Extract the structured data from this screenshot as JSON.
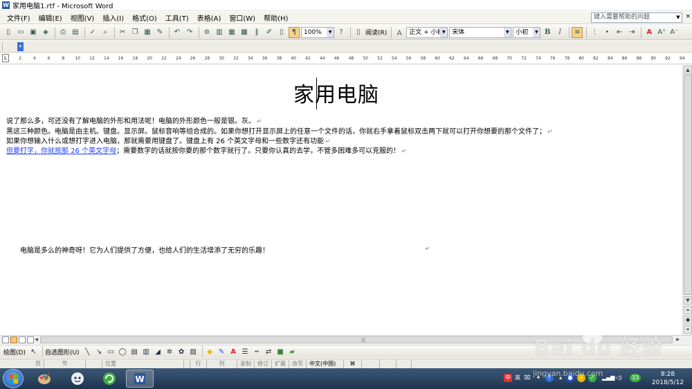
{
  "window": {
    "title": "家用电脑1.rtf - Microsoft Word"
  },
  "menu": {
    "items": [
      "文件(F)",
      "编辑(E)",
      "视图(V)",
      "插入(I)",
      "格式(O)",
      "工具(T)",
      "表格(A)",
      "窗口(W)",
      "帮助(H)"
    ],
    "help_placeholder": "键入需要帮助的问题",
    "close": "×"
  },
  "toolbar": {
    "zoom": "100%",
    "read_label": "阅读(R)",
    "style": "正文 + 小初",
    "font": "宋体",
    "size": "小初",
    "bold": "B",
    "italic": "I"
  },
  "ruler": {
    "ticks": [
      "2",
      "4",
      "6",
      "8",
      "10",
      "12",
      "14",
      "16",
      "18",
      "20",
      "22",
      "24",
      "26",
      "28",
      "30",
      "32",
      "34",
      "36",
      "38",
      "40",
      "42",
      "44",
      "46",
      "48",
      "50",
      "52",
      "54",
      "56",
      "58",
      "60",
      "62",
      "64",
      "66",
      "68",
      "70",
      "72",
      "74",
      "76",
      "78",
      "80",
      "82",
      "84",
      "86",
      "88",
      "90",
      "92",
      "94"
    ]
  },
  "document": {
    "title": "家用电脑",
    "paragraphs": [
      "说了那么多，可还没有了解电脑的外形和用法呢！电脑的外形颜色一般是银。灰。",
      "黑这三种颜色。电脑是由主机。键盘。显示屏。鼠标音响等组合成的。如果你想打开显示屏上的任意一个文件的话，你就右手拿着鼠标双击两下就可以打开你想要的那个文件了；",
      "如果你想输入什么或想打字进入电脑，那就需要用键盘了。键盘上有 26 个英文字母和一些数字还有功能"
    ],
    "line4_link": "但要打字，你就按那 26 个英文字母",
    "line4_rest": "；需要数字的话就按你要的那个数字就行了。只要你认真的去学，不管多困难多可以克服的！",
    "paragraph2": "电脑是多么的神奇呀！它为人们提供了方便，也给人们的生活增添了无穷的乐趣！",
    "return_mark": "↵"
  },
  "drawbar": {
    "draw_label": "绘图(D)",
    "autoshape_label": "自选图形(U)"
  },
  "status": {
    "cells": [
      "页",
      "节",
      "",
      "位置",
      "",
      "行",
      "列",
      "录制",
      "修订",
      "扩展",
      "改写"
    ],
    "language": "中文(中国)"
  },
  "taskbar": {
    "ime": "英",
    "badge": "33",
    "time": "8:28",
    "date": "2018/5/12"
  },
  "watermark": {
    "brand": "Bai du 经验",
    "url": "jingyan.baidu.com"
  }
}
